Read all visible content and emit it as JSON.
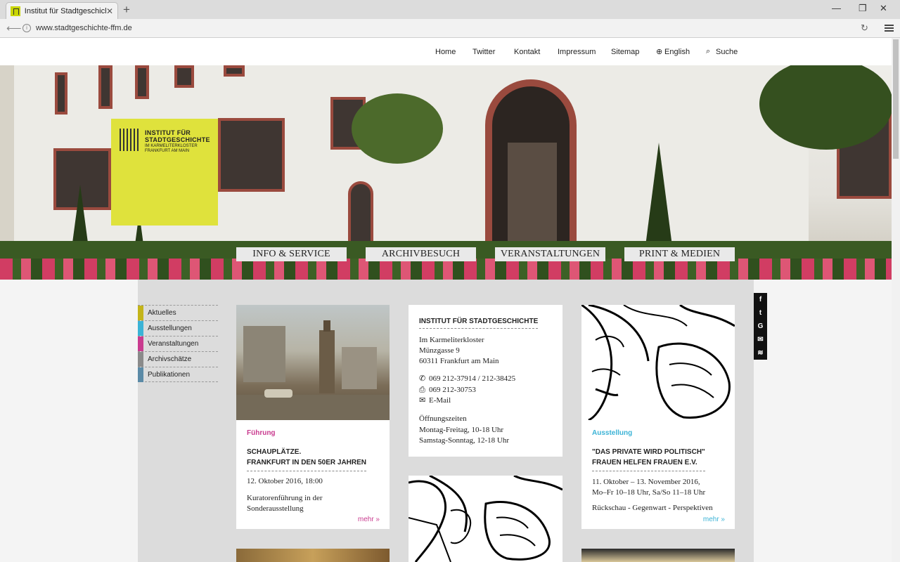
{
  "browser": {
    "tab_title": "Institut für Stadtgeschicht...",
    "tab_close": "✕",
    "new_tab": "+",
    "url": "www.stadtgeschichte-ffm.de",
    "minimize": "—",
    "maximize": "❐",
    "close": "✕"
  },
  "topnav": {
    "items": [
      "Home",
      "Twitter",
      "Kontakt",
      "Impressum",
      "Sitemap",
      "English",
      "Suche"
    ]
  },
  "logo": {
    "line1": "INSTITUT FÜR",
    "line2": "STADTGESCHICHTE",
    "line3": "IM KARMELITERKLOSTER",
    "line4": "FRANKFURT AM MAIN"
  },
  "hero_buttons": [
    "INFO & SERVICE",
    "ARCHIVBESUCH",
    "VERANSTALTUNGEN",
    "PRINT & MEDIEN"
  ],
  "sidenav": {
    "items": [
      {
        "label": "Aktuelles",
        "color": "#c3b41a"
      },
      {
        "label": "Ausstellungen",
        "color": "#3bb3d6"
      },
      {
        "label": "Veranstaltungen",
        "color": "#c93b8f"
      },
      {
        "label": "Archivschätze",
        "color": "#8a8a8a"
      },
      {
        "label": "Publikationen",
        "color": "#5b8aa6"
      }
    ]
  },
  "card1": {
    "category": "Führung",
    "category_color": "#c93b8f",
    "title1": "Schauplätze.",
    "title2": "Frankfurt in den 50er Jahren",
    "date": "12. Oktober 2016, 18:00",
    "desc1": "Kuratorenführung in der",
    "desc2": "Sonderausstellung",
    "more": "mehr »"
  },
  "info": {
    "title": "INSTITUT FÜR STADTGESCHICHTE",
    "addr1": "Im Karmeliterkloster",
    "addr2": "Münzgasse 9",
    "addr3": "60311 Frankfurt am Main",
    "phone": "069 212-37914 / 212-38425",
    "fax": "069 212-30753",
    "email": "E-Mail",
    "hours_title": "Öffnungszeiten",
    "hours1": "Montag-Freitag, 10-18 Uhr",
    "hours2": "Samstag-Sonntag, 12-18 Uhr"
  },
  "card3": {
    "category": "Ausstellung",
    "category_color": "#3bb3d6",
    "title1": "\"Das Private wird politisch\"",
    "title2": "Frauen helfen Frauen e.V.",
    "date1": "11. Oktober – 13. November 2016,",
    "date2": "Mo–Fr 10–18 Uhr, Sa/So 11–18 Uhr",
    "desc": "Rückschau - Gegenwart - Perspektiven",
    "more": "mehr »"
  },
  "social": [
    "f",
    "t",
    "G",
    "✉",
    "≋"
  ]
}
